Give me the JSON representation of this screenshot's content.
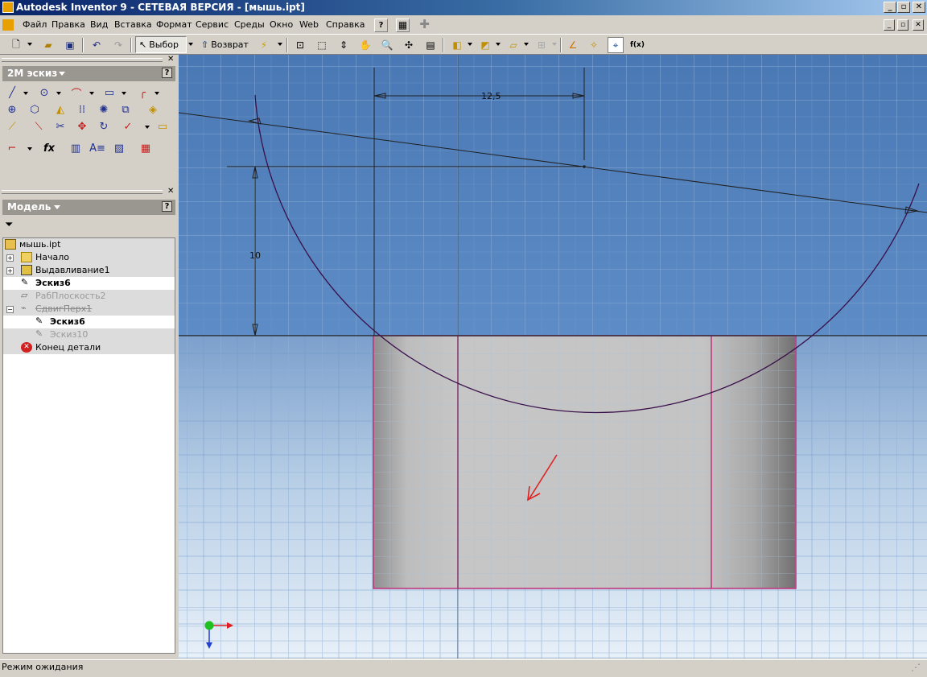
{
  "window": {
    "title": "Autodesk Inventor 9 - СЕТЕВАЯ ВЕРСИЯ - [мышь.ipt]",
    "minimize": "_",
    "restore": "▫",
    "close": "✕"
  },
  "menu": [
    "Файл",
    "Правка",
    "Вид",
    "Вставка",
    "Формат",
    "Сервис",
    "Среды",
    "Окно",
    "Web",
    "Справка"
  ],
  "toolbar": {
    "select_label": "Выбор",
    "return_label": "Возврат"
  },
  "sketch_panel": {
    "title": "2М эскиз"
  },
  "model_panel": {
    "title": "Модель",
    "tree": [
      {
        "label": "мышь.ipt",
        "state": "normal"
      },
      {
        "label": "Начало",
        "state": "normal"
      },
      {
        "label": "Выдавливание1",
        "state": "normal"
      },
      {
        "label": "Эскиз6",
        "state": "active"
      },
      {
        "label": "РабПлоскость2",
        "state": "suppressed"
      },
      {
        "label": "СдвигПерх1",
        "state": "deleted"
      },
      {
        "label": "Эскиз6",
        "state": "active"
      },
      {
        "label": "Эскиз10",
        "state": "suppressed"
      },
      {
        "label": "Конец детали",
        "state": "normal"
      }
    ]
  },
  "viewport": {
    "dimension_horizontal": "12,5",
    "dimension_vertical": "10",
    "sky_color": "#4a78b4",
    "grid_color": "#7ea4d2",
    "body_color": "#bdbdbd",
    "edge_color": "#c0307a"
  },
  "status": {
    "text": "Режим ожидания"
  }
}
